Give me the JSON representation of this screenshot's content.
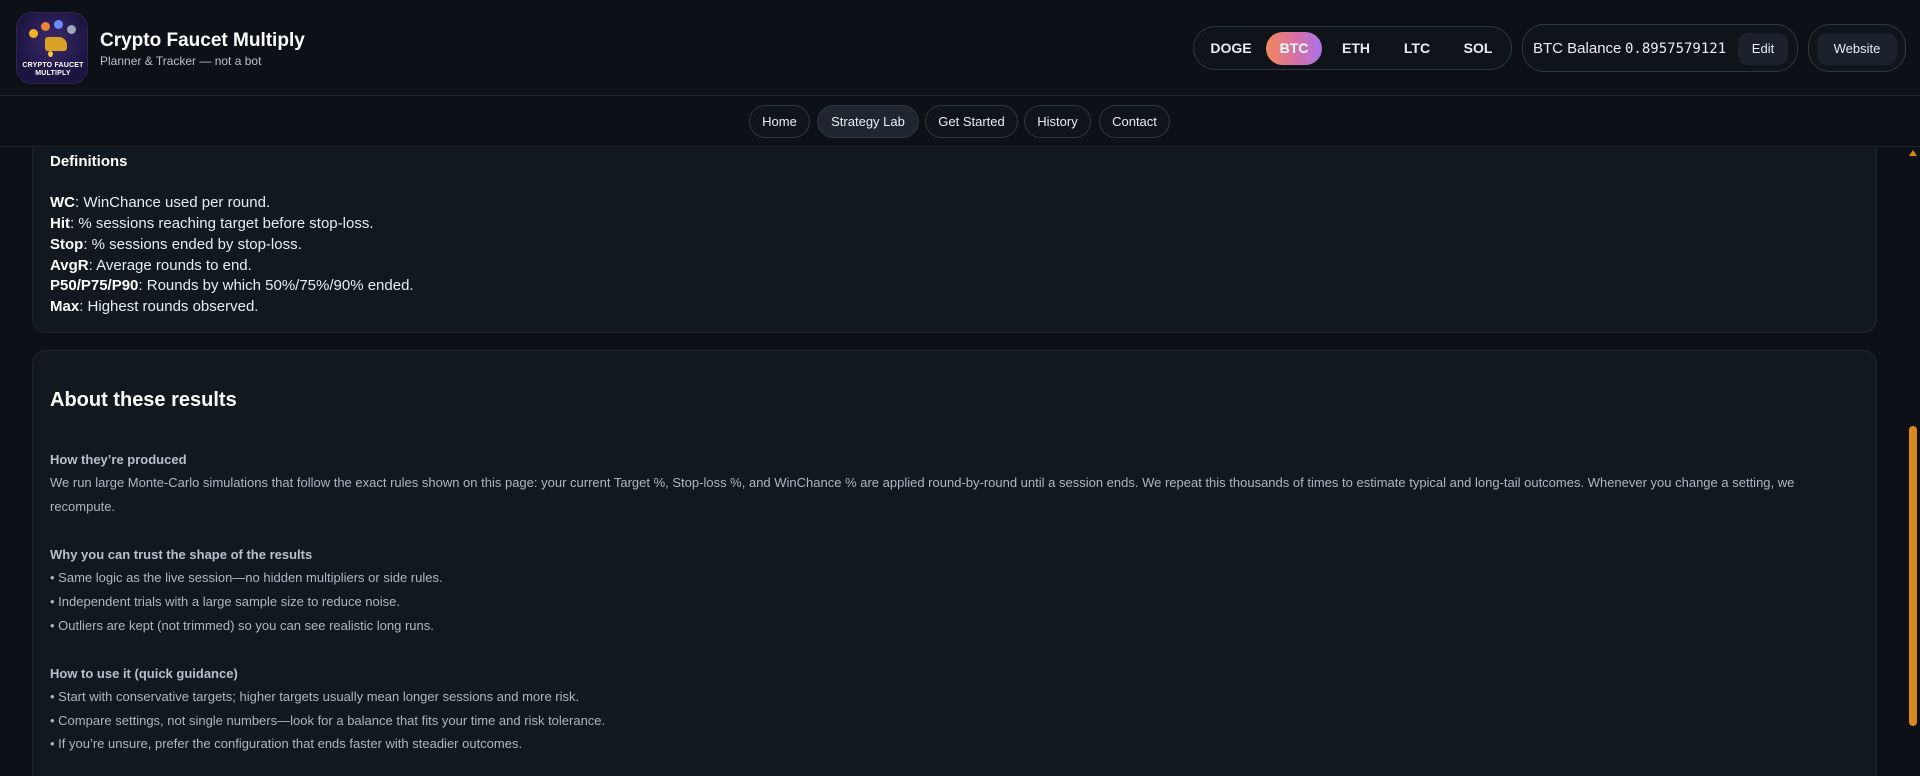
{
  "brand": {
    "logo_text": "CRYPTO FAUCET MULTIPLY",
    "title": "Crypto Faucet Multiply",
    "subtitle": "Planner & Tracker — not a bot"
  },
  "coins": [
    {
      "label": "DOGE",
      "active": false
    },
    {
      "label": "BTC",
      "active": true
    },
    {
      "label": "ETH",
      "active": false
    },
    {
      "label": "LTC",
      "active": false
    },
    {
      "label": "SOL",
      "active": false
    }
  ],
  "balance": {
    "label": "BTC Balance",
    "value": "0.8957579121",
    "edit_label": "Edit"
  },
  "website_label": "Website",
  "nav": [
    {
      "label": "Home",
      "active": false
    },
    {
      "label": "Strategy Lab",
      "active": true
    },
    {
      "label": "Get Started",
      "active": false
    },
    {
      "label": "History",
      "active": false
    },
    {
      "label": "Contact",
      "active": false
    }
  ],
  "definitions": {
    "title": "Definitions",
    "items": [
      {
        "term": "WC",
        "desc": ": WinChance used per round."
      },
      {
        "term": "Hit",
        "desc": ": % sessions reaching target before stop-loss."
      },
      {
        "term": "Stop",
        "desc": ": % sessions ended by stop-loss."
      },
      {
        "term": "AvgR",
        "desc": ": Average rounds to end."
      },
      {
        "term": "P50/P75/P90",
        "desc": ": Rounds by which 50%/75%/90% ended."
      },
      {
        "term": "Max",
        "desc": ": Highest rounds observed."
      }
    ]
  },
  "about": {
    "title": "About these results",
    "produced_head": "How they’re produced",
    "produced_text": "We run large Monte-Carlo simulations that follow the exact rules shown on this page: your current Target %, Stop-loss %, and WinChance % are applied round-by-round until a session ends. We repeat this thousands of times to estimate typical and long-tail outcomes. Whenever you change a setting, we recompute.",
    "trust_head": "Why you can trust the shape of the results",
    "trust_items": [
      "• Same logic as the live session—no hidden multipliers or side rules.",
      "• Independent trials with a large sample size to reduce noise.",
      "• Outliers are kept (not trimmed) so you can see realistic long runs."
    ],
    "howto_head": "How to use it (quick guidance)",
    "howto_items": [
      "• Start with conservative targets; higher targets usually mean longer sessions and more risk.",
      "• Compare settings, not single numbers—look for a balance that fits your time and risk tolerance.",
      "• If you’re unsure, prefer the configuration that ends faster with steadier outcomes."
    ]
  }
}
